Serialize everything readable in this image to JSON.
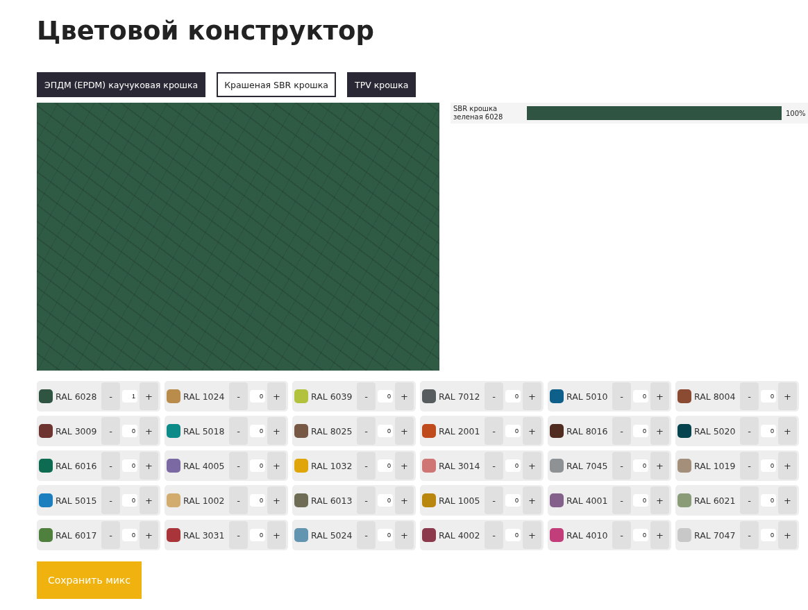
{
  "title": "Цветовой конструктор",
  "tabs": [
    {
      "label": "ЭПДМ (EPDM) каучуковая крошка",
      "selected": false
    },
    {
      "label": "Крашеная SBR крошка",
      "selected": true
    },
    {
      "label": "TPV крошка",
      "selected": false
    }
  ],
  "preview": {
    "color": "#2f5a44"
  },
  "mix": [
    {
      "name": "SBR крошка зеленая 6028",
      "color": "#305442",
      "level": 1,
      "reading": "100%"
    }
  ],
  "colors": [
    {
      "label": "RAL 6028",
      "color": "#2f5442",
      "count": "1"
    },
    {
      "label": "RAL 1024",
      "color": "#b98c4c",
      "count": "0"
    },
    {
      "label": "RAL 6039",
      "color": "#b2c23c",
      "count": "0"
    },
    {
      "label": "RAL 7012",
      "color": "#575d5e",
      "count": "0"
    },
    {
      "label": "RAL 5010",
      "color": "#0e5f8a",
      "count": "0"
    },
    {
      "label": "RAL 8004",
      "color": "#8b4a32",
      "count": "0"
    },
    {
      "label": "RAL 3009",
      "color": "#6e3530",
      "count": "0"
    },
    {
      "label": "RAL 5018",
      "color": "#0d8b89",
      "count": "0"
    },
    {
      "label": "RAL 8025",
      "color": "#775844",
      "count": "0"
    },
    {
      "label": "RAL 2001",
      "color": "#bf4a1c",
      "count": "0"
    },
    {
      "label": "RAL 8016",
      "color": "#4f2b20",
      "count": "0"
    },
    {
      "label": "RAL 5020",
      "color": "#05434e",
      "count": "0"
    },
    {
      "label": "RAL 6016",
      "color": "#0c6b51",
      "count": "0"
    },
    {
      "label": "RAL 4005",
      "color": "#7b69a3",
      "count": "0"
    },
    {
      "label": "RAL 1032",
      "color": "#e0a50a",
      "count": "0"
    },
    {
      "label": "RAL 3014",
      "color": "#cf7574",
      "count": "0"
    },
    {
      "label": "RAL 7045",
      "color": "#8e9295",
      "count": "0"
    },
    {
      "label": "RAL 1019",
      "color": "#a38f7a",
      "count": "0"
    },
    {
      "label": "RAL 5015",
      "color": "#1b7ebf",
      "count": "0"
    },
    {
      "label": "RAL 1002",
      "color": "#d2ab6e",
      "count": "0"
    },
    {
      "label": "RAL 6013",
      "color": "#6f6c55",
      "count": "0"
    },
    {
      "label": "RAL 1005",
      "color": "#b9870d",
      "count": "0"
    },
    {
      "label": "RAL 4001",
      "color": "#83618a",
      "count": "0"
    },
    {
      "label": "RAL 6021",
      "color": "#8a9b78",
      "count": "0"
    },
    {
      "label": "RAL 6017",
      "color": "#4f803d",
      "count": "0"
    },
    {
      "label": "RAL 3031",
      "color": "#a9353a",
      "count": "0"
    },
    {
      "label": "RAL 5024",
      "color": "#6395b0",
      "count": "0"
    },
    {
      "label": "RAL 4002",
      "color": "#8c3a4b",
      "count": "0"
    },
    {
      "label": "RAL 4010",
      "color": "#c23e7a",
      "count": "0"
    },
    {
      "label": "RAL 7047",
      "color": "#c8c8c8",
      "count": "0"
    }
  ],
  "minus": "-",
  "plus": "+",
  "save_button": "Сохранить микс"
}
